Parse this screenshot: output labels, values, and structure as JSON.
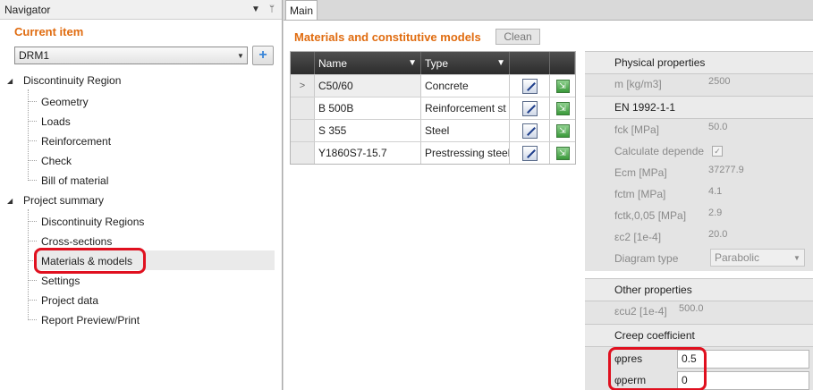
{
  "navigator": {
    "title": "Navigator",
    "dropdown_icon": "▼",
    "pin_icon": "ᛘ",
    "current_item_label": "Current item",
    "current_item_value": "DRM1",
    "add_icon": "+",
    "tree": {
      "discontinuity_region": {
        "label": "Discontinuity Region",
        "children": [
          "Geometry",
          "Loads",
          "Reinforcement",
          "Check",
          "Bill of material"
        ]
      },
      "project_summary": {
        "label": "Project summary",
        "children": [
          "Discontinuity Regions",
          "Cross-sections",
          "Materials & models",
          "Settings",
          "Project data",
          "Report Preview/Print"
        ]
      }
    }
  },
  "main": {
    "tab_label": "Main",
    "title": "Materials and constitutive models",
    "clean_label": "Clean",
    "grid": {
      "headers": {
        "name": "Name",
        "type": "Type"
      },
      "rows": [
        {
          "name": "C50/60",
          "type": "Concrete"
        },
        {
          "name": "B 500B",
          "type": "Reinforcement st"
        },
        {
          "name": "S 355",
          "type": "Steel"
        },
        {
          "name": "Y1860S7-15.7",
          "type": "Prestressing steel"
        }
      ]
    },
    "properties": {
      "physical": {
        "header": "Physical properties",
        "m_label": "m [kg/m3]",
        "m_value": "2500"
      },
      "en": {
        "header": "EN 1992-1-1",
        "fck_label": "fck [MPa]",
        "fck_value": "50.0",
        "calc_label": "Calculate depende",
        "ecm_label": "Ecm [MPa]",
        "ecm_value": "37277.9",
        "fctm_label": "fctm [MPa]",
        "fctm_value": "4.1",
        "fctk_label": "fctk,0,05 [MPa]",
        "fctk_value": "2.9",
        "ec2_label": "εc2 [1e-4]",
        "ec2_value": "20.0",
        "diagram_label": "Diagram type",
        "diagram_value": "Parabolic"
      },
      "other": {
        "header": "Other properties",
        "ecu2_label": "εcu2 [1e-4]",
        "ecu2_value": "500.0"
      },
      "creep": {
        "header": "Creep coefficient",
        "phi_res_label": "φpres",
        "phi_res_value": "0.5",
        "phi_perm_label": "φperm",
        "phi_perm_value": "0"
      }
    }
  }
}
